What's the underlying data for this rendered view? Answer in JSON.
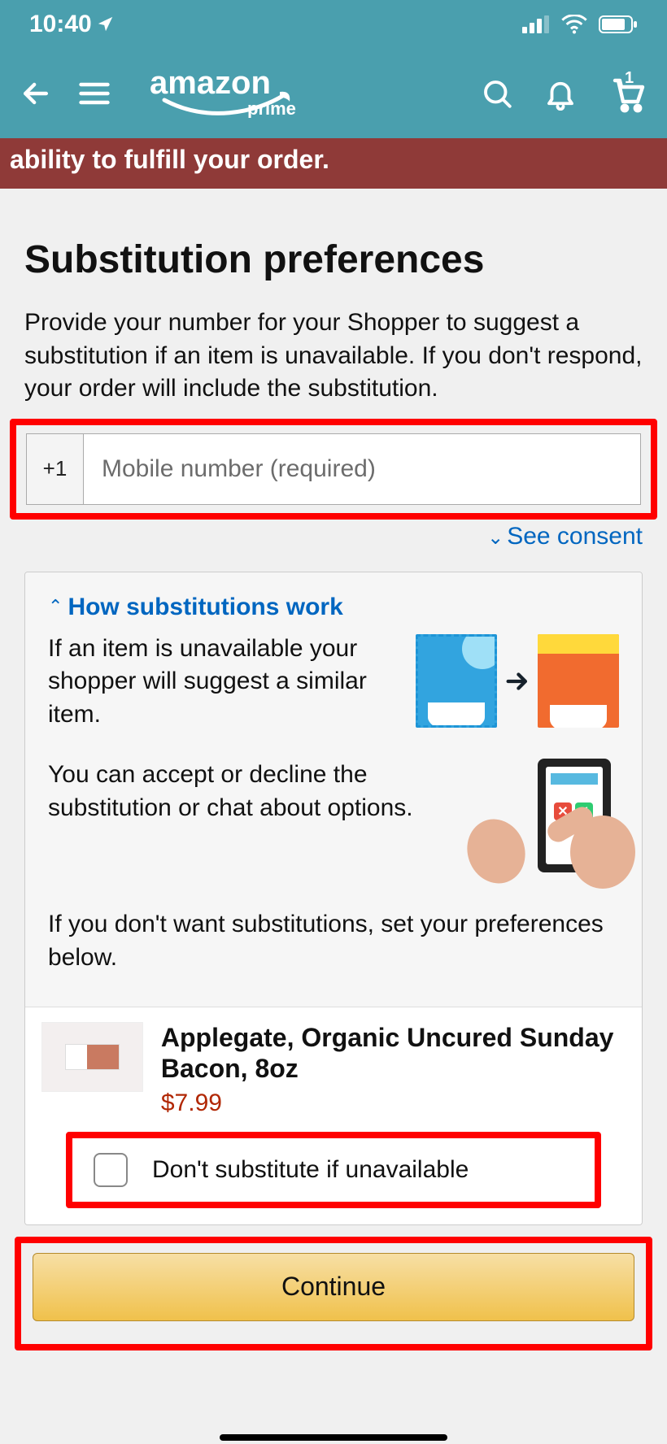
{
  "status": {
    "time": "10:40",
    "cart_count": "1"
  },
  "header": {
    "logo_text": "amazon",
    "logo_sub": "prime"
  },
  "alert": {
    "text": "ability to fulfill your order."
  },
  "page": {
    "title": "Substitution preferences",
    "description": "Provide your number for your Shopper to suggest a substitution if an item is unavailable. If you don't respond, your order will include the substitution."
  },
  "phone": {
    "prefix": "+1",
    "placeholder": "Mobile number (required)",
    "value": ""
  },
  "consent": {
    "label": "See consent"
  },
  "how": {
    "link": "How substitutions work",
    "p1": "If an item is unavailable your shopper will suggest a similar item.",
    "p2": "You can accept or decline the substitution or chat about options.",
    "p3": "If you don't want substitutions, set your preferences below."
  },
  "product": {
    "title": "Applegate, Organic Uncured Sunday Bacon, 8oz",
    "price": "$7.99",
    "dont_substitute_label": "Don't substitute if unavailable"
  },
  "actions": {
    "continue": "Continue"
  }
}
